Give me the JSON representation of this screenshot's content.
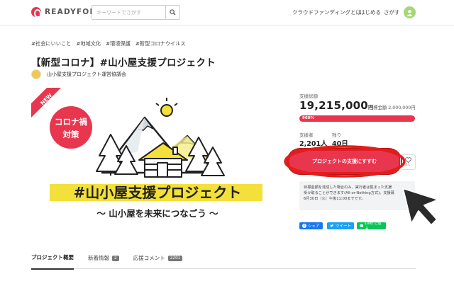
{
  "header": {
    "logo_text": "READYFOR",
    "search_placeholder": "キーワードでさがす",
    "nav": [
      "クラウドファンディングとは",
      "はじめる",
      "さがす"
    ]
  },
  "project": {
    "tags": [
      "#社会にいいこと",
      "#地域文化",
      "#環境保護",
      "#新型コロナウイルス"
    ],
    "title": "【新型コロナ】#山小屋支援プロジェクト",
    "organizer": "山小屋支援プロジェクト運営協議会"
  },
  "hero": {
    "new_label": "NEW",
    "corona_line1": "コロナ禍",
    "corona_line2": "対策",
    "headline": "#山小屋支援プロジェクト",
    "subline": "～ 山小屋を未来につなごう ～"
  },
  "sidebar": {
    "total_label": "支援総額",
    "total_amount": "19,215,000",
    "yen": "円",
    "goal_text": "目標金額 2,000,000円",
    "progress_text": "960%",
    "progress_pct": 960,
    "supporters_label": "支援者",
    "supporters_value": "2,201人",
    "remaining_label": "残り",
    "remaining_value": "40日",
    "support_button": "プロジェクトの支援にすすむ",
    "fav_label": "0人",
    "note_line1": "目標金額を達成した場合のみ、実行者は集まった支援",
    "note_line2": "受け取ることができます(All-or-Nothing方式)。支援募",
    "note_line3": "6月30日（火）午後11:00までです。",
    "share_fb": "シェア",
    "share_tw": "ツイート",
    "share_line": "LINEで送る"
  },
  "tabs": [
    {
      "label": "プロジェクト概要",
      "badge": ""
    },
    {
      "label": "新着情報",
      "badge": "2"
    },
    {
      "label": "応援コメント",
      "badge": "2201"
    }
  ],
  "colors": {
    "brand": "#e8364f",
    "annotation_red": "#e31d1d"
  }
}
